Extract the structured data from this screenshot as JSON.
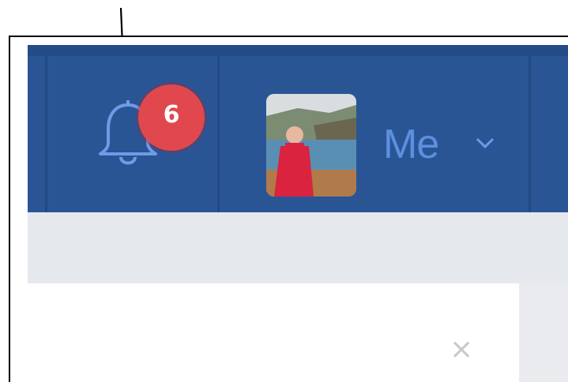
{
  "notifications": {
    "icon": "bell-icon",
    "badge_count": "6",
    "badge_color": "#e0484e"
  },
  "profile": {
    "label": "Me",
    "avatar_icon": "avatar",
    "dropdown_icon": "chevron-down-icon"
  },
  "dialog": {
    "close_label": "×"
  },
  "colors": {
    "navbar": "#2a5595",
    "icon_blue": "#5d8fe0",
    "background": "#e9ebee"
  }
}
